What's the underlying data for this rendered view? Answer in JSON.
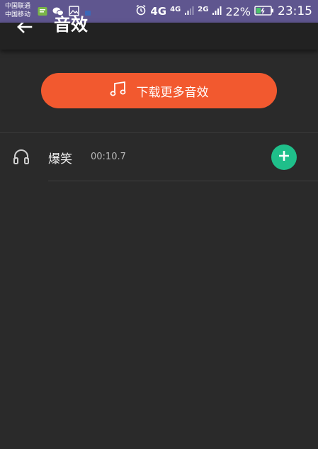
{
  "status_bar": {
    "carrier_1": "中国联通",
    "carrier_2": "中国移动",
    "network_1": "4G",
    "network_2": "4G",
    "network_3": "2G",
    "battery_percent": "22%",
    "time": "23:15",
    "background_color": "#5f568f"
  },
  "header": {
    "title": "音效"
  },
  "download_button": {
    "label": "下载更多音效",
    "color": "#f2592f"
  },
  "sounds": [
    {
      "name": "爆笑",
      "duration": "00:10.7"
    }
  ],
  "colors": {
    "background": "#2a2a2a",
    "add_button": "#1fbf8a"
  }
}
